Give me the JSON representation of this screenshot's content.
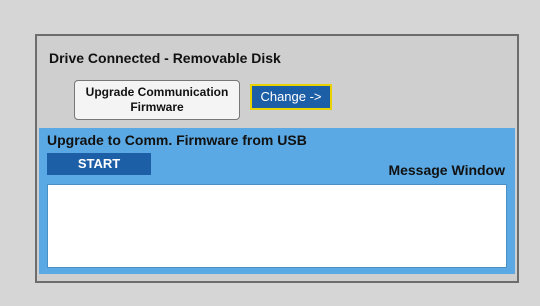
{
  "drive_status": "Drive Connected - Removable Disk",
  "upgrade_button": {
    "line1": "Upgrade Communication",
    "line2": "Firmware"
  },
  "change_button": "Change ->",
  "upgrade_area": {
    "title": "Upgrade to Comm. Firmware from USB",
    "start_button": "START",
    "message_label": "Message Window",
    "message_text": ""
  },
  "colors": {
    "background": "#d6d6d6",
    "panel": "#cfcfcf",
    "accent_blue": "#1d5fa7",
    "area_blue": "#5aa9e4",
    "highlight_border": "#e8d200"
  }
}
